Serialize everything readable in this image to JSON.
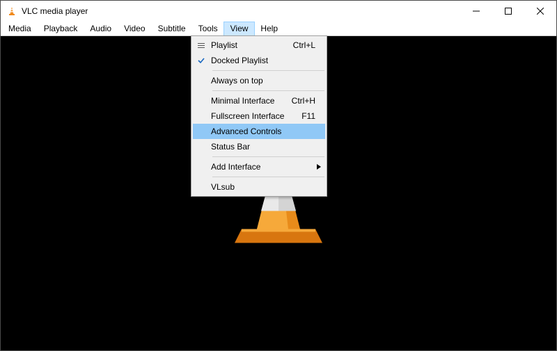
{
  "window": {
    "title": "VLC media player"
  },
  "menubar": {
    "items": [
      {
        "label": "Media"
      },
      {
        "label": "Playback"
      },
      {
        "label": "Audio"
      },
      {
        "label": "Video"
      },
      {
        "label": "Subtitle"
      },
      {
        "label": "Tools"
      },
      {
        "label": "View"
      },
      {
        "label": "Help"
      }
    ],
    "open_index": 6
  },
  "view_menu": {
    "items": [
      {
        "label": "Playlist",
        "accel": "Ctrl+L",
        "icon": "list"
      },
      {
        "label": "Docked Playlist",
        "icon": "check"
      },
      {
        "sep": true
      },
      {
        "label": "Always on top"
      },
      {
        "sep": true
      },
      {
        "label": "Minimal Interface",
        "accel": "Ctrl+H"
      },
      {
        "label": "Fullscreen Interface",
        "accel": "F11"
      },
      {
        "label": "Advanced Controls",
        "highlight": true
      },
      {
        "label": "Status Bar"
      },
      {
        "sep": true
      },
      {
        "label": "Add Interface",
        "submenu": true
      },
      {
        "sep": true
      },
      {
        "label": "VLsub"
      }
    ]
  }
}
